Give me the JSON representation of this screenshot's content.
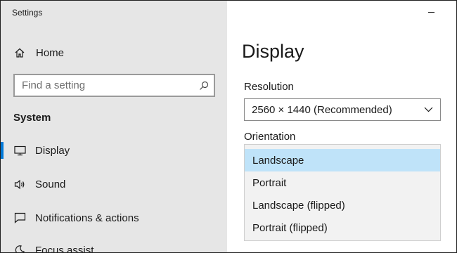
{
  "window": {
    "title": "Settings",
    "minimize_symbol": "–"
  },
  "sidebar": {
    "home": {
      "label": "Home",
      "icon": "home-icon"
    },
    "search": {
      "placeholder": "Find a setting",
      "icon": "search-icon"
    },
    "section_title": "System",
    "items": [
      {
        "label": "Display",
        "icon": "monitor-icon",
        "selected": true
      },
      {
        "label": "Sound",
        "icon": "speaker-icon",
        "selected": false
      },
      {
        "label": "Notifications & actions",
        "icon": "message-icon",
        "selected": false
      },
      {
        "label": "Focus assist",
        "icon": "moon-icon",
        "selected": false
      }
    ]
  },
  "main": {
    "page_title": "Display",
    "resolution": {
      "label": "Resolution",
      "value": "2560 × 1440 (Recommended)",
      "icon": "chevron-down-icon"
    },
    "orientation": {
      "label": "Orientation",
      "options": [
        {
          "label": "Landscape",
          "selected": true
        },
        {
          "label": "Portrait",
          "selected": false
        },
        {
          "label": "Landscape (flipped)",
          "selected": false
        },
        {
          "label": "Portrait (flipped)",
          "selected": false
        }
      ]
    }
  },
  "colors": {
    "accent": "#0078d7",
    "sidebar_bg": "#e6e6e6",
    "selected_option_bg": "#bfe3f9",
    "dropdown_list_bg": "#f2f2f2"
  }
}
